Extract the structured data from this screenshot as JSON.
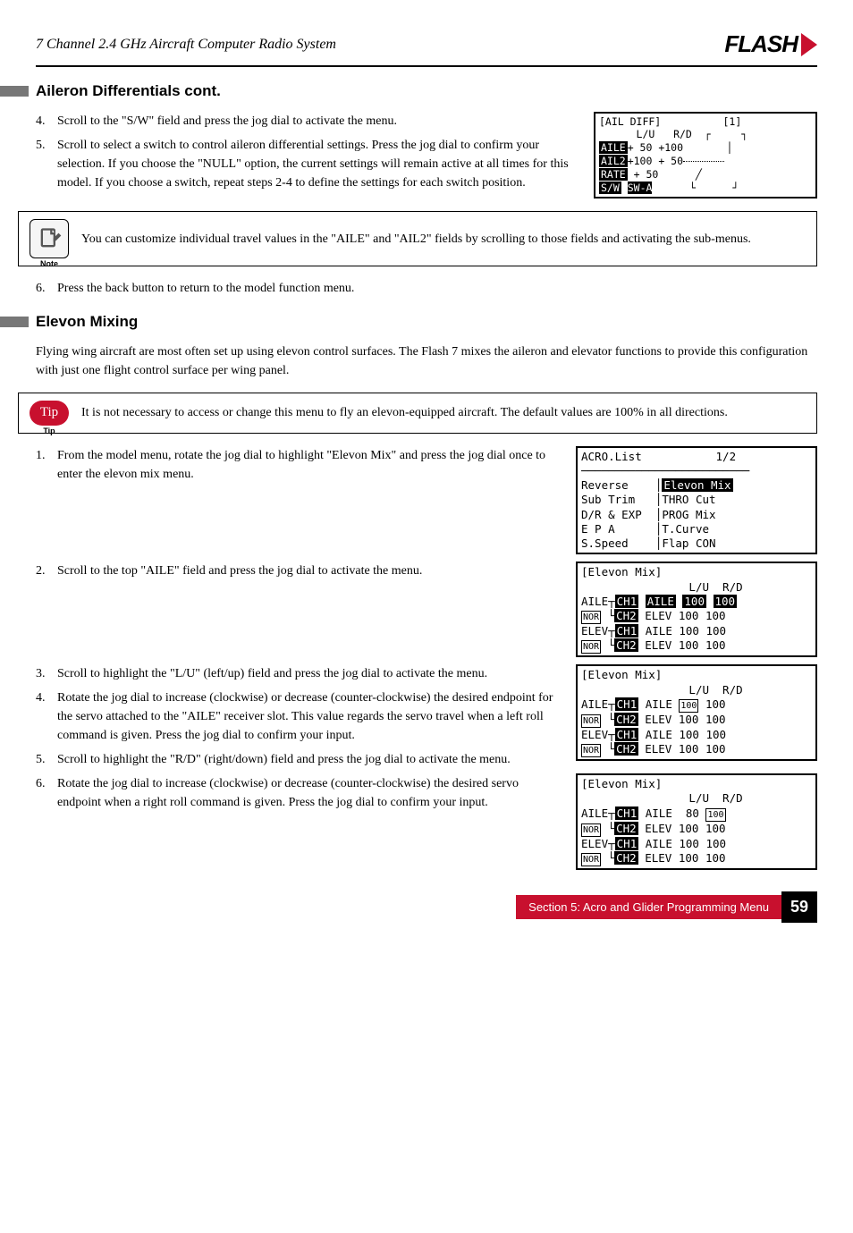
{
  "header": {
    "title": "7 Channel 2.4 GHz Aircraft Computer Radio System",
    "brand": "FLASH"
  },
  "section1": {
    "heading": "Aileron Differentials cont.",
    "step4": "Scroll to the \"S/W\" field and press the jog dial to activate the menu.",
    "step5": "Scroll to select a switch to control aileron differential settings. Press the jog dial to confirm your selection. If you choose the \"NULL\" option, the current settings will remain active at all times for this model. If you choose a switch, repeat steps 2-4 to define the settings for each switch position.",
    "step6": "Press the back button to return to the model function menu.",
    "note": "You can customize individual travel values in the \"AILE\" and \"AIL2\" fields by scrolling to those fields and activating the sub-menus."
  },
  "screen_aildiff": {
    "title": "[AIL DIFF]",
    "badge": "[1]",
    "headers": "L/U   R/D",
    "r1": "AILE+ 50 +100",
    "r2": "AIL2+100 + 50",
    "r3": "RATE + 50",
    "r4": "S/W SW-A"
  },
  "section2": {
    "heading": "Elevon Mixing",
    "intro": "Flying wing aircraft are most often set up using elevon control surfaces. The Flash 7 mixes the aileron and elevator functions to provide this configuration with just one flight control surface per wing panel.",
    "tip": "It is not necessary to access or change this menu to fly an elevon-equipped aircraft. The default values are 100% in all directions.",
    "step1": "From the model menu, rotate the jog dial to highlight \"Elevon Mix\" and press the jog dial once to enter the elevon mix menu.",
    "step2": "Scroll to the top \"AILE\" field and press the jog dial to activate the menu.",
    "step3": "Scroll to highlight the \"L/U\" (left/up) field and press the jog dial to activate the menu.",
    "step4": "Rotate the jog dial to increase (clockwise) or decrease (counter-clockwise) the desired endpoint for the servo attached to the \"AILE\" receiver slot. This value regards the servo travel when a left roll command is given. Press the jog dial to confirm your input.",
    "step5": "Scroll to highlight the \"R/D\" (right/down) field and press the jog dial to activate the menu.",
    "step6": "Rotate the jog dial to increase (clockwise) or decrease (counter-clockwise) the desired servo endpoint when a right roll command is given. Press the jog dial to confirm your input."
  },
  "screen_acro": {
    "title": "ACRO.List",
    "page": "1/2",
    "c1": [
      "Reverse",
      "Sub Trim",
      "D/R & EXP",
      "E P A",
      "S.Speed"
    ],
    "c2": [
      "Elevon Mix",
      "THRO Cut",
      "PROG Mix",
      "T.Curve",
      "Flap CON"
    ]
  },
  "screen_elevon1": {
    "title": "[Elevon Mix]",
    "cols": "L/U  R/D",
    "r1": "AILE┬CH1 AILE 100 100",
    "r2": "NOR └CH2 ELEV 100 100",
    "r3": "ELEV┬CH1 AILE 100 100",
    "r4": "NOR └CH2 ELEV 100 100"
  },
  "screen_elevon2": {
    "title": "[Elevon Mix]",
    "cols": "L/U  R/D",
    "r1": "AILE┬CH1 AILE 100 100",
    "r2": "NOR └CH2 ELEV 100 100",
    "r3": "ELEV┬CH1 AILE 100 100",
    "r4": "NOR └CH2 ELEV 100 100"
  },
  "screen_elevon3": {
    "title": "[Elevon Mix]",
    "cols": "L/U  R/D",
    "r1": "AILE┬CH1 AILE  80 100",
    "r2": "NOR └CH2 ELEV 100 100",
    "r3": "ELEV┬CH1 AILE 100 100",
    "r4": "NOR └CH2 ELEV 100 100"
  },
  "footer": {
    "section": "Section 5: Acro and Glider Programming Menu",
    "page": "59"
  },
  "labels": {
    "note": "Note",
    "tip": "Tip",
    "tip_text": "Tip"
  }
}
